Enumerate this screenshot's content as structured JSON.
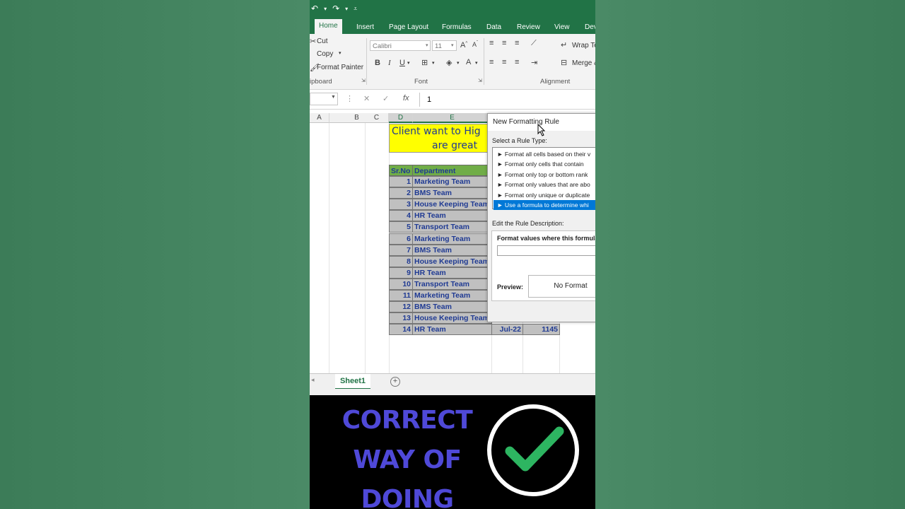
{
  "quick_access": {
    "undo": "↶",
    "redo": "↷"
  },
  "ribbon_tabs": [
    "Home",
    "Insert",
    "Page Layout",
    "Formulas",
    "Data",
    "Review",
    "View",
    "Dev"
  ],
  "clipboard": {
    "cut": "Cut",
    "copy": "Copy",
    "format_painter": "Format Painter",
    "group": "ipboard"
  },
  "font": {
    "name": "Calibri",
    "size": "11",
    "bold": "B",
    "italic": "I",
    "underline": "U",
    "group": "Font"
  },
  "alignment": {
    "wrap": "Wrap Te",
    "merge": "Merge &",
    "group": "Alignment"
  },
  "formula_bar": {
    "value": "1",
    "fx": "fx"
  },
  "columns": [
    "A",
    "B",
    "C",
    "D",
    "E"
  ],
  "sheet": {
    "banner_line1": "Client want to Hig",
    "banner_line2": "are great",
    "header_srno": "Sr.No",
    "header_dept": "Department",
    "rows": [
      {
        "n": "1",
        "dept": "Marketing Team"
      },
      {
        "n": "2",
        "dept": "BMS Team"
      },
      {
        "n": "3",
        "dept": "House Keeping Team"
      },
      {
        "n": "4",
        "dept": "HR Team"
      },
      {
        "n": "5",
        "dept": "Transport Team"
      },
      {
        "n": "6",
        "dept": "Marketing Team"
      },
      {
        "n": "7",
        "dept": "BMS Team"
      },
      {
        "n": "8",
        "dept": "House Keeping Team"
      },
      {
        "n": "9",
        "dept": "HR Team"
      },
      {
        "n": "10",
        "dept": "Transport Team"
      },
      {
        "n": "11",
        "dept": "Marketing Team"
      },
      {
        "n": "12",
        "dept": "BMS Team"
      },
      {
        "n": "13",
        "dept": "House Keeping Team"
      },
      {
        "n": "14",
        "dept": "HR Team"
      }
    ],
    "last_row_month": "Jul-22",
    "last_row_amount": "1145",
    "tab_name": "Sheet1"
  },
  "dialog": {
    "title": "New Formatting Rule",
    "select_label": "Select a Rule Type:",
    "rules": [
      "► Format all cells based on their v",
      "► Format only cells that contain",
      "► Format only top or bottom rank",
      "► Format only values that are abo",
      "► Format only unique or duplicate",
      "► Use a formula to determine whi"
    ],
    "edit_label": "Edit the Rule Description:",
    "formula_label": "Format values where this formula",
    "preview_label": "Preview:",
    "preview_text": "No Format"
  },
  "promo": {
    "line1": "CORRECT",
    "line2": "WAY OF",
    "line3": "DOING",
    "check_color": "#2db561"
  }
}
